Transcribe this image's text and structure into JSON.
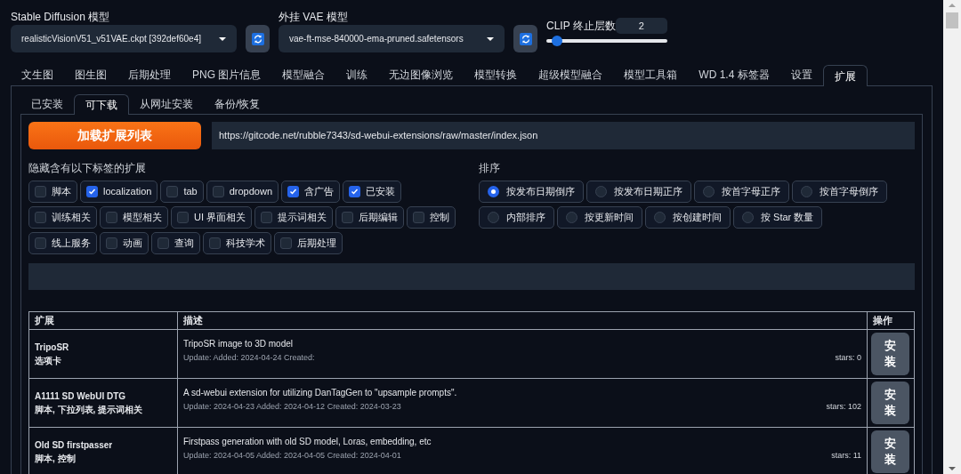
{
  "model_selects": [
    {
      "label": "Stable Diffusion 模型",
      "value": "realisticVisionV51_v51VAE.ckpt [392def60e4]"
    },
    {
      "label": "外挂 VAE 模型",
      "value": "vae-ft-mse-840000-ema-pruned.safetensors"
    }
  ],
  "clip": {
    "label": "CLIP 终止层数",
    "value": "2",
    "level": 0.09
  },
  "tabs": [
    {
      "label": "文生图",
      "selected": false
    },
    {
      "label": "图生图",
      "selected": false
    },
    {
      "label": "后期处理",
      "selected": false
    },
    {
      "label": "PNG 图片信息",
      "selected": false
    },
    {
      "label": "模型融合",
      "selected": false
    },
    {
      "label": "训练",
      "selected": false
    },
    {
      "label": "无边图像浏览",
      "selected": false
    },
    {
      "label": "模型转换",
      "selected": false
    },
    {
      "label": "超级模型融合",
      "selected": false
    },
    {
      "label": "模型工具箱",
      "selected": false
    },
    {
      "label": "WD 1.4 标签器",
      "selected": false
    },
    {
      "label": "设置",
      "selected": false
    },
    {
      "label": "扩展",
      "selected": true
    }
  ],
  "subtabs": [
    {
      "label": "已安装",
      "selected": false
    },
    {
      "label": "可下载",
      "selected": true
    },
    {
      "label": "从网址安装",
      "selected": false
    },
    {
      "label": "备份/恢复",
      "selected": false
    }
  ],
  "load_button": "加载扩展列表",
  "url_field": {
    "value": "https://gitcode.net/rubble7343/sd-webui-extensions/raw/master/index.json"
  },
  "hide_tags": {
    "label": "隐藏含有以下标签的扩展",
    "options": [
      {
        "label": "脚本",
        "checked": false
      },
      {
        "label": "localization",
        "checked": true
      },
      {
        "label": "tab",
        "checked": false
      },
      {
        "label": "dropdown",
        "checked": false
      },
      {
        "label": "含广告",
        "checked": true
      },
      {
        "label": "已安装",
        "checked": true
      },
      {
        "label": "训练相关",
        "checked": false
      },
      {
        "label": "模型相关",
        "checked": false
      },
      {
        "label": "UI 界面相关",
        "checked": false
      },
      {
        "label": "提示词相关",
        "checked": false
      },
      {
        "label": "后期编辑",
        "checked": false
      },
      {
        "label": "控制",
        "checked": false
      },
      {
        "label": "线上服务",
        "checked": false
      },
      {
        "label": "动画",
        "checked": false
      },
      {
        "label": "查询",
        "checked": false
      },
      {
        "label": "科技学术",
        "checked": false
      },
      {
        "label": "后期处理",
        "checked": false
      }
    ]
  },
  "sort": {
    "label": "排序",
    "rows": [
      [
        {
          "label": "按发布日期倒序",
          "selected": true
        },
        {
          "label": "按发布日期正序",
          "selected": false
        },
        {
          "label": "按首字母正序",
          "selected": false
        },
        {
          "label": "按首字母倒序",
          "selected": false
        }
      ],
      [
        {
          "label": "内部排序",
          "selected": false
        },
        {
          "label": "按更新时间",
          "selected": false
        },
        {
          "label": "按创建时间",
          "selected": false
        },
        {
          "label": "按 Star 数量",
          "selected": false
        }
      ]
    ]
  },
  "table": {
    "columns": [
      "扩展",
      "描述",
      "操作"
    ],
    "rows": [
      {
        "name": "TripoSR",
        "tags": "选项卡",
        "description": "TripoSR image to 3D model",
        "dates": "Update: Added: 2024-04-24 Created:",
        "stars": "stars: 0",
        "action": "安装"
      },
      {
        "name": "A1111 SD WebUI DTG",
        "tags": "脚本, 下拉列表, 提示词相关",
        "description": "A sd-webui extension for utilizing DanTagGen to \"upsample prompts\".",
        "dates": "Update: 2024-04-23 Added: 2024-04-12 Created: 2024-03-23",
        "stars": "stars: 102",
        "action": "安装"
      },
      {
        "name": "Old SD firstpasser",
        "tags": "脚本, 控制",
        "description": "Firstpass generation with old SD model, Loras, embedding, etc",
        "dates": "Update: 2024-04-05 Added: 2024-04-05 Created: 2024-04-01",
        "stars": "stars: 11",
        "action": "安装"
      }
    ]
  }
}
